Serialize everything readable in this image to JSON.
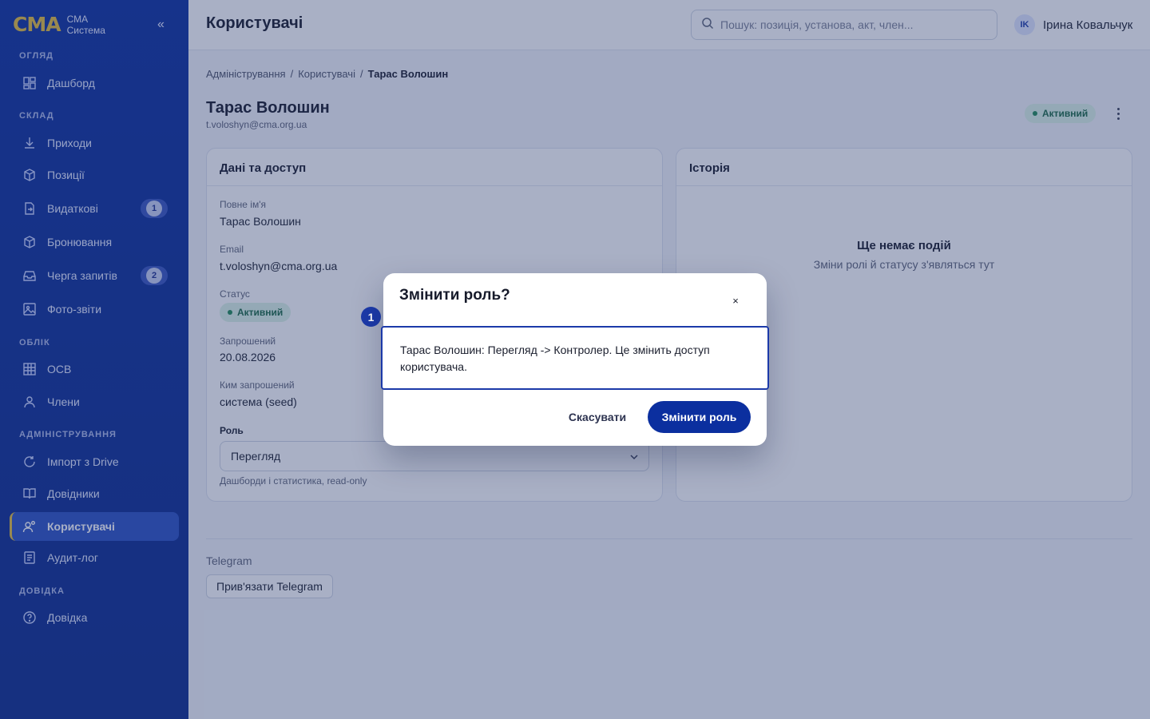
{
  "brand": {
    "logo": "CMA",
    "line1": "СМА",
    "line2": "Система",
    "collapse_glyph": "«"
  },
  "sidebar": {
    "sections": {
      "overview": "ОГЛЯД",
      "warehouse": "СКЛАД",
      "accounting": "ОБЛІК",
      "admin": "АДМІНІСТРУВАННЯ",
      "help": "ДОВІДКА"
    },
    "items": [
      {
        "label": "Дашборд",
        "icon": "dashboard-icon"
      },
      {
        "label": "Приходи",
        "icon": "download-icon"
      },
      {
        "label": "Позиції",
        "icon": "box-icon"
      },
      {
        "label": "Видаткові",
        "icon": "document-out-icon",
        "badge": "1"
      },
      {
        "label": "Бронювання",
        "icon": "box-icon"
      },
      {
        "label": "Черга запитів",
        "icon": "inbox-icon",
        "badge": "2"
      },
      {
        "label": "Фото-звіти",
        "icon": "image-icon"
      },
      {
        "label": "ОСВ",
        "icon": "table-icon"
      },
      {
        "label": "Члени",
        "icon": "person-icon"
      },
      {
        "label": "Імпорт з Drive",
        "icon": "refresh-icon"
      },
      {
        "label": "Довідники",
        "icon": "book-icon"
      },
      {
        "label": "Користувачі",
        "icon": "users-icon",
        "active": true
      },
      {
        "label": "Аудит-лог",
        "icon": "log-icon"
      },
      {
        "label": "Довідка",
        "icon": "help-icon"
      }
    ]
  },
  "header": {
    "title": "Користувачі",
    "search_placeholder": "Пошук: позиція, установа, акт, член...",
    "user_initials": "IK",
    "user_name": "Ірина Ковальчук"
  },
  "breadcrumb": [
    "Адміністрування",
    "/",
    "Користувачі",
    "/",
    "Тарас Волошин"
  ],
  "profile": {
    "name": "Тарас Волошин",
    "email": "t.voloshyn@cma.org.ua",
    "status": "Активний"
  },
  "details_card": {
    "title": "Дані та доступ",
    "full_name_label": "Повне ім'я",
    "full_name": "Тарас Волошин",
    "email_label": "Email",
    "email": "t.voloshyn@cma.org.ua",
    "status_label": "Статус",
    "status": "Активний",
    "invited_label": "Запрошений",
    "invited": "20.08.2026",
    "invited_by_label": "Ким запрошений",
    "invited_by": "система (seed)",
    "role_label": "Роль",
    "role_value": "Перегляд",
    "role_help": "Дашборди і статистика, read-only"
  },
  "history_card": {
    "title": "Історія",
    "empty_title": "Ще немає подій",
    "empty_subtitle": "Зміни ролі й статусу з'являться тут"
  },
  "telegram": {
    "label": "Telegram",
    "button": "Прив'язати Telegram"
  },
  "modal": {
    "title": "Змінити роль?",
    "close_glyph": "×",
    "body": "Тарас Волошин: Перегляд -> Контролер. Це змінить доступ користувача.",
    "cancel": "Скасувати",
    "confirm": "Змінити роль",
    "step_marker": "1"
  },
  "colors": {
    "sidebar": "#0a2f9e",
    "accent_gold": "#e4bf3b",
    "primary": "#0b2f9f",
    "status_green": "#1e8a55"
  }
}
